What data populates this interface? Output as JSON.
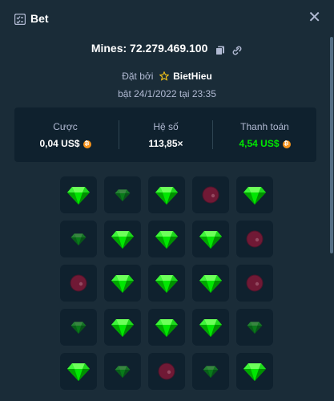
{
  "header": {
    "title": "Bet",
    "close_icon": "close-icon",
    "bet_icon": "bet-slip-icon"
  },
  "game_line": {
    "text": "Mines: 72.279.469.100",
    "copy_icon": "copy-icon",
    "link_icon": "link-icon"
  },
  "placed_by": {
    "label": "Đặt bởi",
    "user": "BietHieu",
    "icon": "star-icon"
  },
  "date": "bật 24/1/2022 tại 23:35",
  "stats": {
    "bet": {
      "label": "Cược",
      "value": "0,04 US$"
    },
    "multiplier": {
      "label": "Hệ số",
      "value": "113,85×"
    },
    "payout": {
      "label": "Thanh toán",
      "value": "4,54 US$"
    },
    "currency_icon": "bitcoin-icon"
  },
  "colors": {
    "background": "#1a2c38",
    "panel": "#0f212e",
    "gem": "#00e701",
    "mine": "#8b0f2f",
    "text_white": "#ffffff",
    "text_muted": "#b1bad3"
  },
  "board": [
    [
      "gem",
      "gem-dim",
      "gem",
      "mine-dim",
      "gem"
    ],
    [
      "gem-dim",
      "gem",
      "gem",
      "gem",
      "mine-dim"
    ],
    [
      "mine-dim",
      "gem",
      "gem",
      "gem",
      "mine-dim"
    ],
    [
      "gem-dim",
      "gem",
      "gem",
      "gem",
      "gem-dim"
    ],
    [
      "gem",
      "gem-dim",
      "mine-dim",
      "gem-dim",
      "gem"
    ]
  ]
}
